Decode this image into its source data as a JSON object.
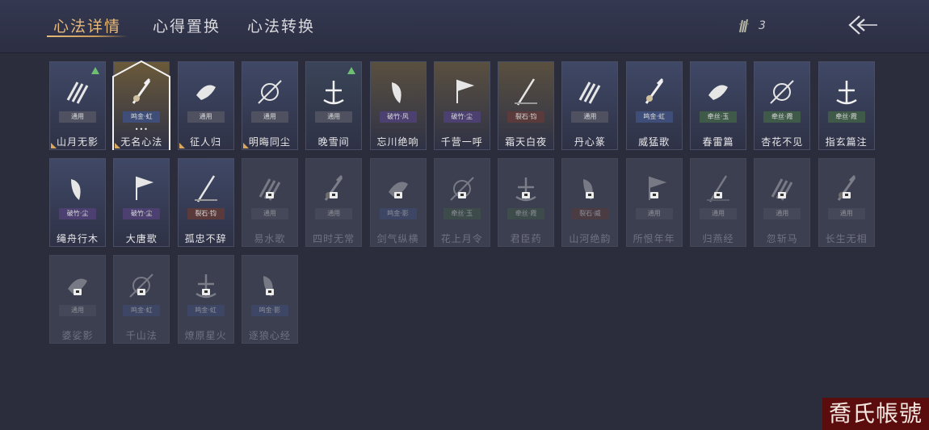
{
  "tabs": [
    {
      "label": "心法详情",
      "active": true
    },
    {
      "label": "心得置换",
      "active": false
    },
    {
      "label": "心法转换",
      "active": false
    }
  ],
  "currency": {
    "count": "3",
    "icon": "feather-icon"
  },
  "badge_colors": {
    "通用": "#4f5160",
    "鸣金·虹": "#3e4e78",
    "鸣金·影": "#3e4e78",
    "破竹·风": "#4b4070",
    "破竹·尘": "#4b4070",
    "裂石·钧": "#5a3a3a",
    "裂石·威": "#5a3a3a",
    "牵丝·玉": "#3f5a48",
    "牵丝·霞": "#3f5a48"
  },
  "cards": [
    {
      "name": "山月无影",
      "badge": "通用",
      "locked": false,
      "bg": "#3f4866",
      "up": true,
      "corner": true,
      "icon": "claw-slash-icon"
    },
    {
      "name": "无名心法",
      "badge": "鸣金·虹",
      "locked": false,
      "bg": "#6b5a3a",
      "selected": true,
      "dots": "•••",
      "corner": true,
      "icon": "sword-tassel-icon"
    },
    {
      "name": "征人归",
      "badge": "通用",
      "locked": false,
      "bg": "#3f4866",
      "corner": true,
      "icon": "raven-icon"
    },
    {
      "name": "明晦同尘",
      "badge": "通用",
      "locked": false,
      "bg": "#3f4866",
      "corner": true,
      "icon": "serpent-sword-icon"
    },
    {
      "name": "晚雪间",
      "badge": "通用",
      "locked": false,
      "bg": "#3a4458",
      "up": true,
      "icon": "cross-anchor-icon"
    },
    {
      "name": "忘川绝响",
      "badge": "破竹·风",
      "locked": false,
      "bg": "#5a5040",
      "icon": "weeping-face-icon"
    },
    {
      "name": "千营一呼",
      "badge": "破竹·尘",
      "locked": false,
      "bg": "#5a5040",
      "icon": "war-banner-icon"
    },
    {
      "name": "霜天白夜",
      "badge": "裂石·钧",
      "locked": false,
      "bg": "#5a5040",
      "icon": "planted-sword-icon"
    },
    {
      "name": "丹心篆",
      "badge": "通用",
      "locked": false,
      "bg": "#3f4866",
      "icon": "stamp-seal-icon"
    },
    {
      "name": "威猛歌",
      "badge": "鸣金·虹",
      "locked": false,
      "bg": "#3f4866",
      "icon": "praying-hands-icon"
    },
    {
      "name": "春雷篇",
      "badge": "牵丝·玉",
      "locked": false,
      "bg": "#3f4866",
      "icon": "lightning-tree-icon"
    },
    {
      "name": "杏花不见",
      "badge": "牵丝·霞",
      "locked": false,
      "bg": "#3f4866",
      "icon": "apricot-blossom-icon"
    },
    {
      "name": "指玄篇注",
      "badge": "牵丝·霞",
      "locked": false,
      "bg": "#3f4866",
      "icon": "yin-yang-icon"
    },
    {
      "name": "绳舟行木",
      "badge": "破竹·尘",
      "locked": false,
      "bg": "#3f4866",
      "icon": "old-tree-icon"
    },
    {
      "name": "大唐歌",
      "badge": "破竹·尘",
      "locked": false,
      "bg": "#3f4866",
      "icon": "palace-icon"
    },
    {
      "name": "孤忠不辞",
      "badge": "裂石·钧",
      "locked": false,
      "bg": "#3f4866",
      "icon": "crossed-spears-icon"
    },
    {
      "name": "易水歌",
      "badge": "通用",
      "locked": true,
      "icon": "wolf-icon"
    },
    {
      "name": "四时无常",
      "badge": "通用",
      "locked": true,
      "icon": "wave-icon"
    },
    {
      "name": "剑气纵横",
      "badge": "鸣金·影",
      "locked": true,
      "icon": "sword-circle-icon"
    },
    {
      "name": "花上月令",
      "badge": "牵丝·玉",
      "locked": true,
      "icon": "moon-icon"
    },
    {
      "name": "君臣药",
      "badge": "牵丝·霞",
      "locked": true,
      "icon": "herb-icon"
    },
    {
      "name": "山河绝韵",
      "badge": "裂石·威",
      "locked": true,
      "icon": "mountain-icon"
    },
    {
      "name": "所恨年年",
      "badge": "通用",
      "locked": true,
      "icon": "cloud-icon"
    },
    {
      "name": "归燕经",
      "badge": "通用",
      "locked": true,
      "icon": "swallow-icon"
    },
    {
      "name": "忽斩马",
      "badge": "通用",
      "locked": true,
      "icon": "blade-icon"
    },
    {
      "name": "长生无相",
      "badge": "通用",
      "locked": true,
      "icon": "statue-icon"
    },
    {
      "name": "婆娑影",
      "badge": "通用",
      "locked": true,
      "icon": "dragon-icon"
    },
    {
      "name": "千山法",
      "badge": "鸣金·虹",
      "locked": true,
      "icon": "peaks-icon"
    },
    {
      "name": "燎原星火",
      "badge": "鸣金·虹",
      "locked": true,
      "icon": "crescent-blade-icon"
    },
    {
      "name": "逐狼心经",
      "badge": "鸣金·影",
      "locked": true,
      "icon": "wolf-head-icon"
    }
  ],
  "watermark": "喬氏帳號"
}
